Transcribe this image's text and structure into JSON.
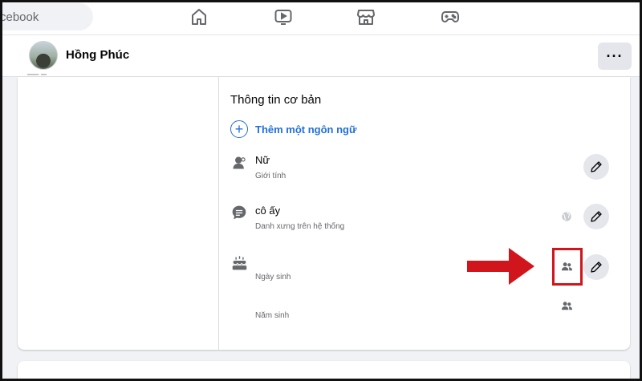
{
  "topbar": {
    "search_placeholder": "cebook",
    "nav_icons": [
      "home-icon",
      "watch-icon",
      "marketplace-icon",
      "gaming-icon"
    ]
  },
  "profile": {
    "name": "Hồng Phúc",
    "more_label": "···"
  },
  "about": {
    "section_title": "Thông tin cơ bản",
    "add_language": "Thêm một ngôn ngữ",
    "rows": [
      {
        "icon": "gender-icon",
        "value": "Nữ",
        "label": "Giới tính"
      },
      {
        "icon": "pronoun-icon",
        "value": "cô ấy",
        "label": "Danh xưng trên hệ thống"
      },
      {
        "icon": "birthday-cake-icon",
        "value": "",
        "label": "Ngày sinh"
      },
      {
        "icon": "",
        "value": "",
        "label": "Năm sinh"
      }
    ]
  },
  "colors": {
    "link_blue": "#216fdb",
    "annotation_red": "#d0161c",
    "button_gray": "#e4e6eb"
  }
}
